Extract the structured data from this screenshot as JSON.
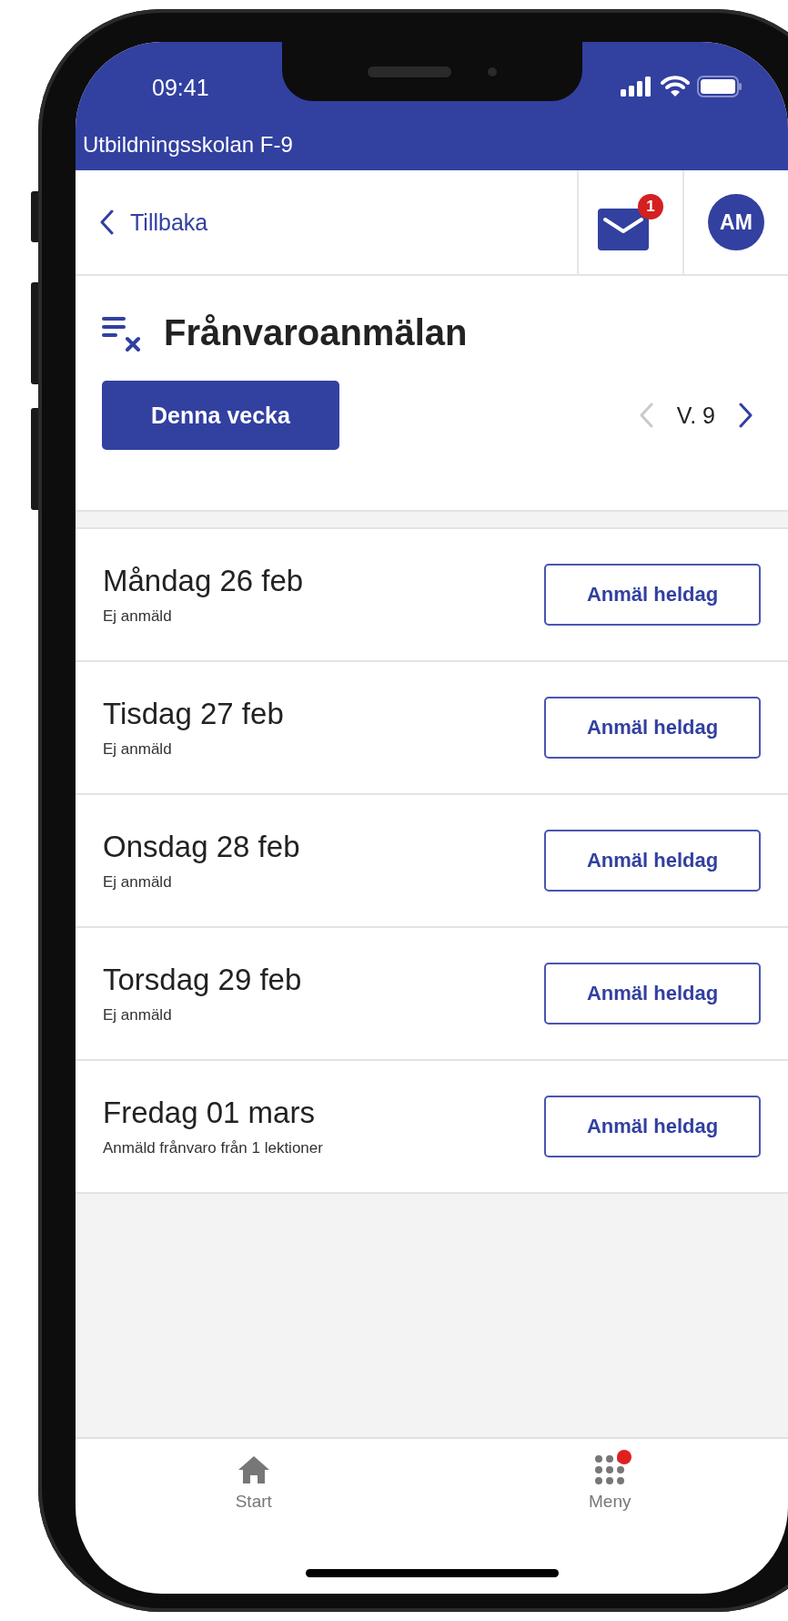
{
  "status_bar": {
    "time": "09:41"
  },
  "app_bar": {
    "title": "Utbildningsskolan F-9"
  },
  "header": {
    "back_label": "Tillbaka",
    "mail_badge": "1",
    "avatar_initials": "AM"
  },
  "page": {
    "title": "Frånvaroanmälan",
    "this_week_button": "Denna vecka",
    "week_label": "V. 9",
    "prev_disabled": true,
    "next_disabled": false
  },
  "days": [
    {
      "date": "Måndag 26 feb",
      "status": "Ej anmäld",
      "button": "Anmäl heldag"
    },
    {
      "date": "Tisdag 27 feb",
      "status": "Ej anmäld",
      "button": "Anmäl heldag"
    },
    {
      "date": "Onsdag 28 feb",
      "status": "Ej anmäld",
      "button": "Anmäl heldag"
    },
    {
      "date": "Torsdag 29 feb",
      "status": "Ej anmäld",
      "button": "Anmäl heldag"
    },
    {
      "date": "Fredag 01 mars",
      "status": "Anmäld frånvaro från 1 lektioner",
      "button": "Anmäl heldag"
    }
  ],
  "bottom_nav": [
    {
      "label": "Start",
      "kind": "home",
      "badge": false
    },
    {
      "label": "Meny",
      "kind": "menu",
      "badge": true
    }
  ]
}
